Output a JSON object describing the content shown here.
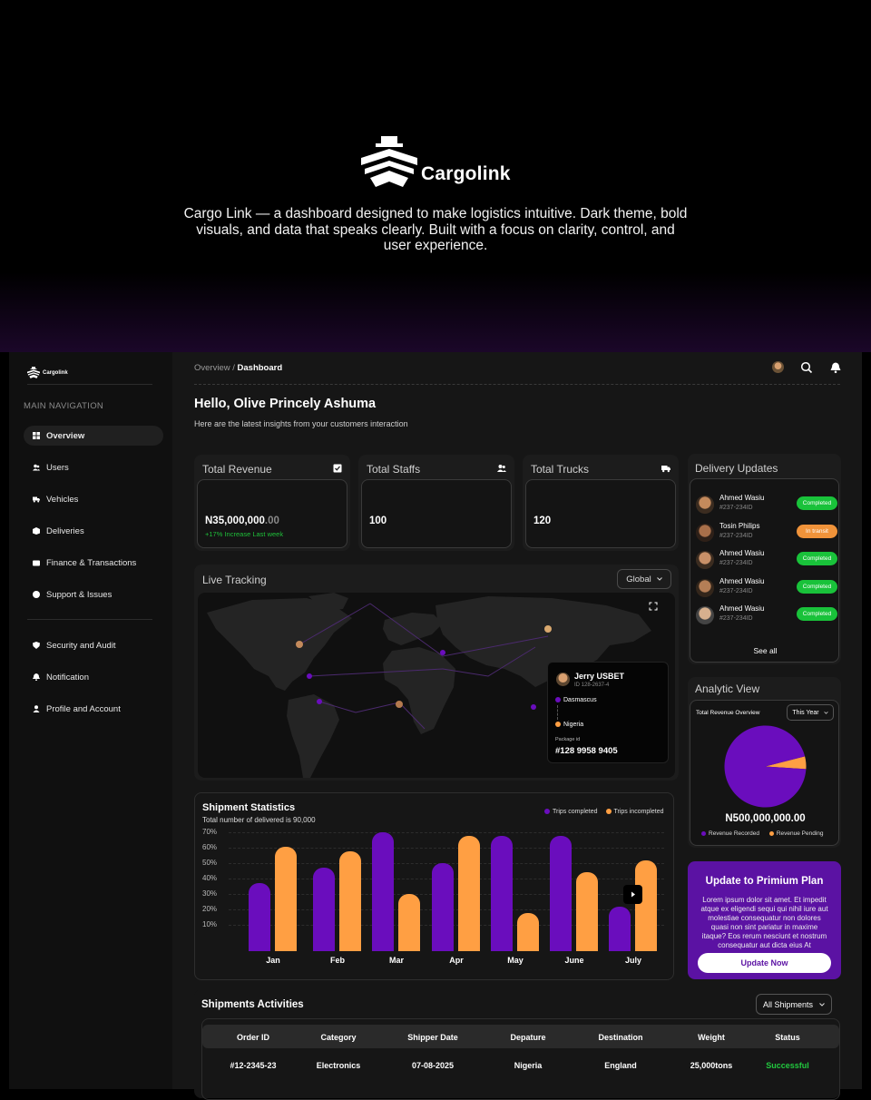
{
  "brand": {
    "name": "Cargolink",
    "description": "Cargo Link — a dashboard designed to make logistics intuitive. Dark theme, bold visuals, and data that speaks clearly. Built with a focus on clarity, control, and user experience."
  },
  "sidebar": {
    "logo_text": "Cargolink",
    "section_label": "MAIN NAVIGATION",
    "items": [
      {
        "label": "Overview",
        "icon": "grid-icon"
      },
      {
        "label": "Users",
        "icon": "users-icon"
      },
      {
        "label": "Vehicles",
        "icon": "truck-icon"
      },
      {
        "label": "Deliveries",
        "icon": "box-icon"
      },
      {
        "label": "Finance & Transactions",
        "icon": "wallet-icon"
      },
      {
        "label": "Support & Issues",
        "icon": "support-icon"
      }
    ],
    "secondary_items": [
      {
        "label": "Security and Audit",
        "icon": "shield-icon"
      },
      {
        "label": "Notification",
        "icon": "bell-icon"
      },
      {
        "label": "Profile and Account",
        "icon": "user-icon"
      }
    ]
  },
  "header": {
    "crumb_parent": "Overview",
    "crumb_sep": " / ",
    "crumb_current": "Dashboard"
  },
  "greeting": {
    "title": "Hello, Olive Princely Ashuma",
    "subtitle": "Here are the latest insights from your customers interaction"
  },
  "stats": {
    "revenue": {
      "title": "Total Revenue",
      "value": "N35,000,000",
      "decimals": ".00",
      "note": "+17% Increase Last week"
    },
    "staffs": {
      "title": "Total Staffs",
      "value": "100"
    },
    "trucks": {
      "title": "Total Trucks",
      "value": "120"
    }
  },
  "tracking": {
    "title": "Live Tracking",
    "filter": "Global",
    "popup": {
      "name": "Jerry USBET",
      "id": "ID 128-2637-4",
      "origin": "Dasmascus",
      "destination": "Nigeria",
      "package_label": "Package id",
      "package_id": "#128 9958 9405"
    }
  },
  "shipment": {
    "title": "Shipment Statistics",
    "subtitle": "Total number of delivered is 90,000",
    "legend": [
      "Trips completed",
      "Trips incompleted"
    ]
  },
  "chart_data": {
    "type": "bar",
    "categories": [
      "Jan",
      "Feb",
      "Mar",
      "Apr",
      "May",
      "June",
      "July"
    ],
    "y_ticks": [
      "70%",
      "60%",
      "50%",
      "40%",
      "30%",
      "20%",
      "10%"
    ],
    "ylim": [
      0,
      75
    ],
    "series": [
      {
        "name": "Trips completed",
        "color": "#6a0dbd",
        "values": [
          44,
          54,
          77,
          57,
          75,
          75,
          29
        ]
      },
      {
        "name": "Trips incompleted",
        "color": "#ff9f43",
        "values": [
          68,
          65,
          37,
          75,
          25,
          51,
          59
        ]
      }
    ]
  },
  "deliveries": {
    "title": "Delivery Updates",
    "items": [
      {
        "name": "Ahmed Wasiu",
        "id": "#237-234ID",
        "status": "Completed",
        "status_color": "#19c23a"
      },
      {
        "name": "Tosin Philips",
        "id": "#237-234ID",
        "status": "In transit",
        "status_color": "#f0933a"
      },
      {
        "name": "Ahmed Wasiu",
        "id": "#237-234ID",
        "status": "Completed",
        "status_color": "#19c23a"
      },
      {
        "name": "Ahmed Wasiu",
        "id": "#237-234ID",
        "status": "Completed",
        "status_color": "#19c23a"
      },
      {
        "name": "Ahmed Wasiu",
        "id": "#237-234ID",
        "status": "Completed",
        "status_color": "#19c23a"
      }
    ],
    "see_all": "See all"
  },
  "analytics": {
    "title": "Analytic View",
    "card_title": "Total Revenue Overview",
    "period": "This Year",
    "total": "N500,000,000.00",
    "legend": [
      "Revenue Recorded",
      "Revenue Pending"
    ],
    "pie": [
      {
        "label": "Revenue Recorded",
        "value": 95,
        "color": "#6a0dbd"
      },
      {
        "label": "Revenue Pending",
        "value": 5,
        "color": "#ff9f43"
      }
    ]
  },
  "premium": {
    "title": "Update to Primium Plan",
    "text": "Lorem ipsum dolor sit amet. Et impedit atque ex eligendi sequi qui nihil iure aut molestiae consequatur non dolores quasi non sint pariatur in maxime itaque? Eos rerum nesciunt et nostrum consequatur aut dicta eius At",
    "button": "Update Now"
  },
  "activities": {
    "title": "Shipments Activities",
    "filter": "All Shipments",
    "columns": [
      "Order ID",
      "Category",
      "Shipper Date",
      "Depature",
      "Destination",
      "Weight",
      "Status"
    ],
    "rows": [
      [
        "#12-2345-23",
        "Electronics",
        "07-08-2025",
        "Nigeria",
        "England",
        "25,000tons",
        "Successful"
      ]
    ]
  }
}
